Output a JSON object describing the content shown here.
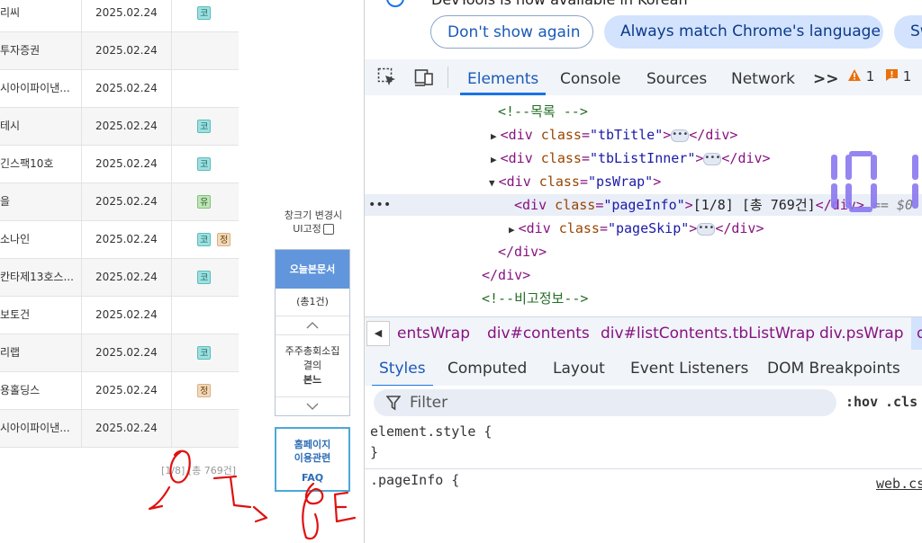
{
  "table": {
    "rows": [
      {
        "name": "리씨",
        "date": "2025.02.24",
        "tags": [
          {
            "label": "코",
            "color": "mint"
          }
        ]
      },
      {
        "name": "투자증권",
        "date": "2025.02.24",
        "tags": []
      },
      {
        "name": "시아이파이낸...",
        "date": "2025.02.24",
        "tags": []
      },
      {
        "name": "테시",
        "date": "2025.02.24",
        "tags": [
          {
            "label": "코",
            "color": "mint"
          }
        ]
      },
      {
        "name": "긴스팩10호",
        "date": "2025.02.24",
        "tags": [
          {
            "label": "코",
            "color": "mint"
          }
        ]
      },
      {
        "name": "을",
        "date": "2025.02.24",
        "tags": [
          {
            "label": "유",
            "color": "green"
          }
        ]
      },
      {
        "name": "소나인",
        "date": "2025.02.24",
        "tags": [
          {
            "label": "코",
            "color": "mint"
          },
          {
            "label": "정",
            "color": "beige"
          }
        ]
      },
      {
        "name": "칸타제13호스...",
        "date": "2025.02.24",
        "tags": [
          {
            "label": "코",
            "color": "mint"
          }
        ]
      },
      {
        "name": "보토건",
        "date": "2025.02.24",
        "tags": []
      },
      {
        "name": "리랩",
        "date": "2025.02.24",
        "tags": [
          {
            "label": "코",
            "color": "mint"
          }
        ]
      },
      {
        "name": "용홀딩스",
        "date": "2025.02.24",
        "tags": [
          {
            "label": "정",
            "color": "beige"
          }
        ]
      },
      {
        "name": "시아이파이낸...",
        "date": "2025.02.24",
        "tags": []
      }
    ],
    "page_info": "[1/8] [총 769건]"
  },
  "side_panel": {
    "window_label_line1": "창크기 변경시",
    "window_label_line2": "UI고정",
    "today_title": "오늘본문서",
    "count": "(총1건)",
    "item_line1": "주주총회소집",
    "item_line2": "결의",
    "item_line3": "본느",
    "faq_line1": "홈페이지",
    "faq_line2": "이용관련",
    "faq_label": "FAQ"
  },
  "devtools": {
    "infobar": {
      "message": "DevTools is now available in Korean",
      "dont_show": "Don't show again",
      "always_match": "Always match Chrome's language",
      "switch": "Sw"
    },
    "tabs": [
      "Elements",
      "Console",
      "Sources",
      "Network"
    ],
    "active_tab": "Elements",
    "more_tabs": ">>",
    "warnings": "1",
    "errors": "1",
    "dom": {
      "comment_list": "<!--목록 -->",
      "tag_div": "div",
      "attr_class": "class",
      "val_tbTitle": "\"tbTitle\"",
      "val_tbListInner": "\"tbListInner\"",
      "val_psWrap": "\"psWrap\"",
      "val_pageInfo": "\"pageInfo\"",
      "val_pageSkip": "\"pageSkip\"",
      "pageinfo_text": "[1/8] [총 769건]",
      "eq0": "== $0",
      "comment_note": "<!--비고정보-->",
      "close_div": "</div>"
    },
    "breadcrumbs": [
      "entsWrap",
      "div#contents",
      "div#listContents.tbListWrap",
      "div.psWrap",
      "d"
    ],
    "subtabs": [
      "Styles",
      "Computed",
      "Layout",
      "Event Listeners",
      "DOM Breakpoints"
    ],
    "active_subtab": "Styles",
    "filter_placeholder": "Filter",
    "hov": ":hov",
    "cls": ".cls",
    "styles": {
      "element_style": "element.style {",
      "close_brace": "}",
      "pageinfo_rule": ".pageInfo {",
      "source": "web.cs"
    }
  },
  "colors": {
    "accent": "#1a73e8",
    "panel_blue": "#6196dc",
    "annotation_red": "#e01010",
    "digit_purple": "#8a78f0"
  }
}
